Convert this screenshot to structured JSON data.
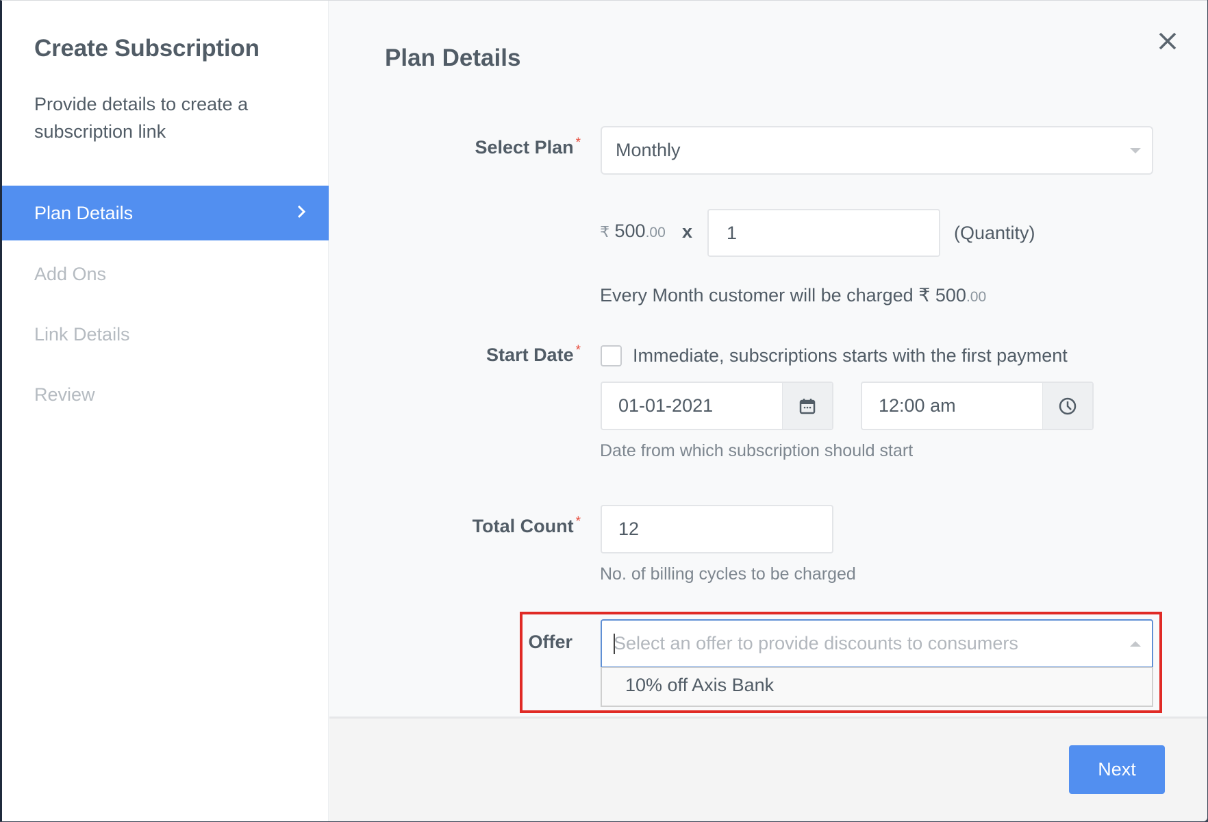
{
  "sidebar": {
    "title": "Create Subscription",
    "subtitle": "Provide details to create a subscription link",
    "items": [
      {
        "label": "Plan Details",
        "active": true
      },
      {
        "label": "Add Ons",
        "active": false
      },
      {
        "label": "Link Details",
        "active": false
      },
      {
        "label": "Review",
        "active": false
      }
    ]
  },
  "main": {
    "title": "Plan Details",
    "close_icon": "close-icon"
  },
  "form": {
    "select_plan": {
      "label": "Select Plan",
      "required_mark": "*",
      "value": "Monthly"
    },
    "price": {
      "currency": "₹",
      "amount_whole": " 500",
      "amount_decimal": ".00",
      "multiplier": "x",
      "quantity": "1",
      "quantity_label": "(Quantity)"
    },
    "charge_summary": {
      "text": "Every Month customer will be charged ₹ 500",
      "decimal": ".00"
    },
    "start_date": {
      "label": "Start Date",
      "required_mark": "*",
      "immediate_label": "Immediate, subscriptions starts with the first payment",
      "immediate_checked": false,
      "date_value": "01-01-2021",
      "date_icon": "calendar-icon",
      "time_value": "12:00 am",
      "time_icon": "clock-icon",
      "help": "Date from which subscription should start"
    },
    "total_count": {
      "label": "Total Count",
      "required_mark": "*",
      "value": "12",
      "help": "No. of billing cycles to be charged"
    },
    "offer": {
      "label": "Offer",
      "placeholder": "Select an offer to provide discounts to consumers",
      "options": [
        "10% off Axis Bank"
      ]
    }
  },
  "footer": {
    "next_label": "Next"
  },
  "colors": {
    "accent": "#528ff0",
    "required": "#e74c3c",
    "highlight": "#e02a25"
  }
}
